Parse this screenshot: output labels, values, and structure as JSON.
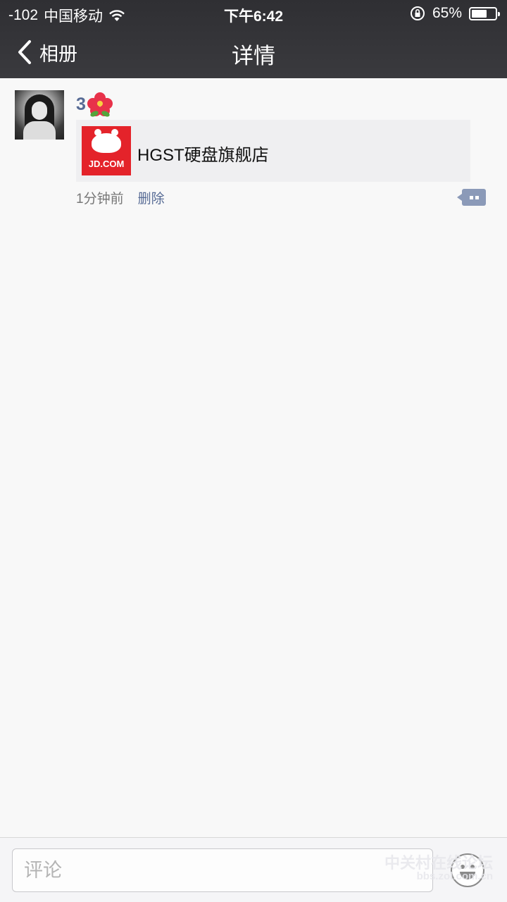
{
  "status_bar": {
    "signal": "-102",
    "carrier": "中国移动",
    "time": "下午6:42",
    "battery_text": "65%",
    "battery_level": 0.65
  },
  "nav": {
    "back_label": "相册",
    "title": "详情"
  },
  "post": {
    "username": "3",
    "username_emoji": "hibiscus-icon",
    "share_card": {
      "thumb_brand": "JD.COM",
      "title": "HGST硬盘旗舰店"
    },
    "time": "1分钟前",
    "delete_label": "删除"
  },
  "comment_bar": {
    "placeholder": "评论"
  },
  "watermark": {
    "main": "中关村在线论坛",
    "url": "bbs.zol.com.cn"
  },
  "colors": {
    "nav_bg": "#333337",
    "link": "#576b95",
    "jd_red": "#e4232a",
    "page_bg": "#f8f8f8"
  }
}
